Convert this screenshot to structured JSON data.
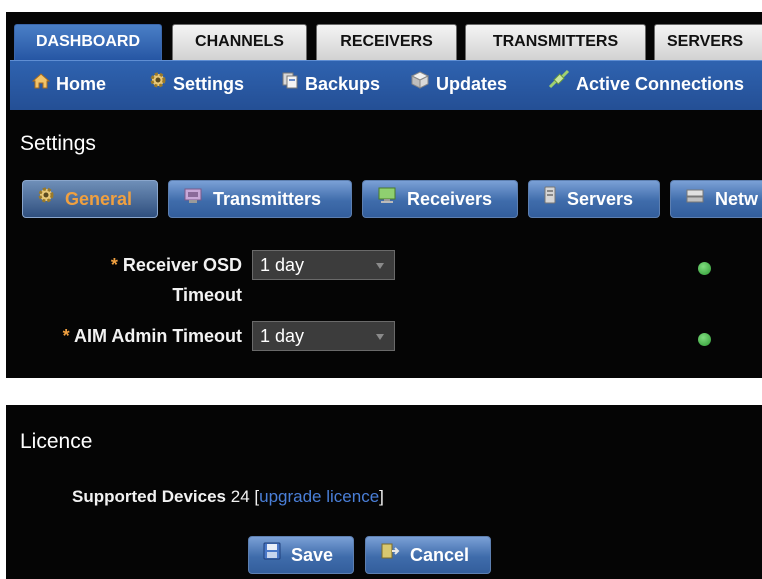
{
  "top_tabs": [
    "DASHBOARD",
    "CHANNELS",
    "RECEIVERS",
    "TRANSMITTERS",
    "SERVERS"
  ],
  "sub_nav": [
    {
      "label": "Home",
      "icon": "home-icon"
    },
    {
      "label": "Settings",
      "icon": "gear-icon"
    },
    {
      "label": "Backups",
      "icon": "backup-icon"
    },
    {
      "label": "Updates",
      "icon": "updates-icon"
    },
    {
      "label": "Active Connections",
      "icon": "connections-icon"
    }
  ],
  "settings": {
    "title": "Settings",
    "buttons": [
      {
        "label": "General",
        "icon": "gear-icon",
        "active": true
      },
      {
        "label": "Transmitters",
        "icon": "transmitter-icon"
      },
      {
        "label": "Receivers",
        "icon": "monitor-icon"
      },
      {
        "label": "Servers",
        "icon": "server-icon"
      },
      {
        "label": "Netw",
        "icon": "network-icon"
      }
    ],
    "fields": [
      {
        "required_mark": "*",
        "label_line1": "Receiver OSD",
        "label_line2": "Timeout",
        "value": "1 day"
      },
      {
        "required_mark": "*",
        "label_line1": "AIM Admin Timeout",
        "value": "1 day"
      }
    ]
  },
  "licence": {
    "title": "Licence",
    "supported_label": "Supported Devices",
    "supported_count": "24",
    "bracket_open": "[",
    "upgrade_link": "upgrade licence",
    "bracket_close": "]",
    "save": "Save",
    "cancel": "Cancel"
  },
  "colors": {
    "accent_blue": "#2f63b0",
    "active_orange": "#f0a040",
    "ok_green": "#2e9a33"
  }
}
